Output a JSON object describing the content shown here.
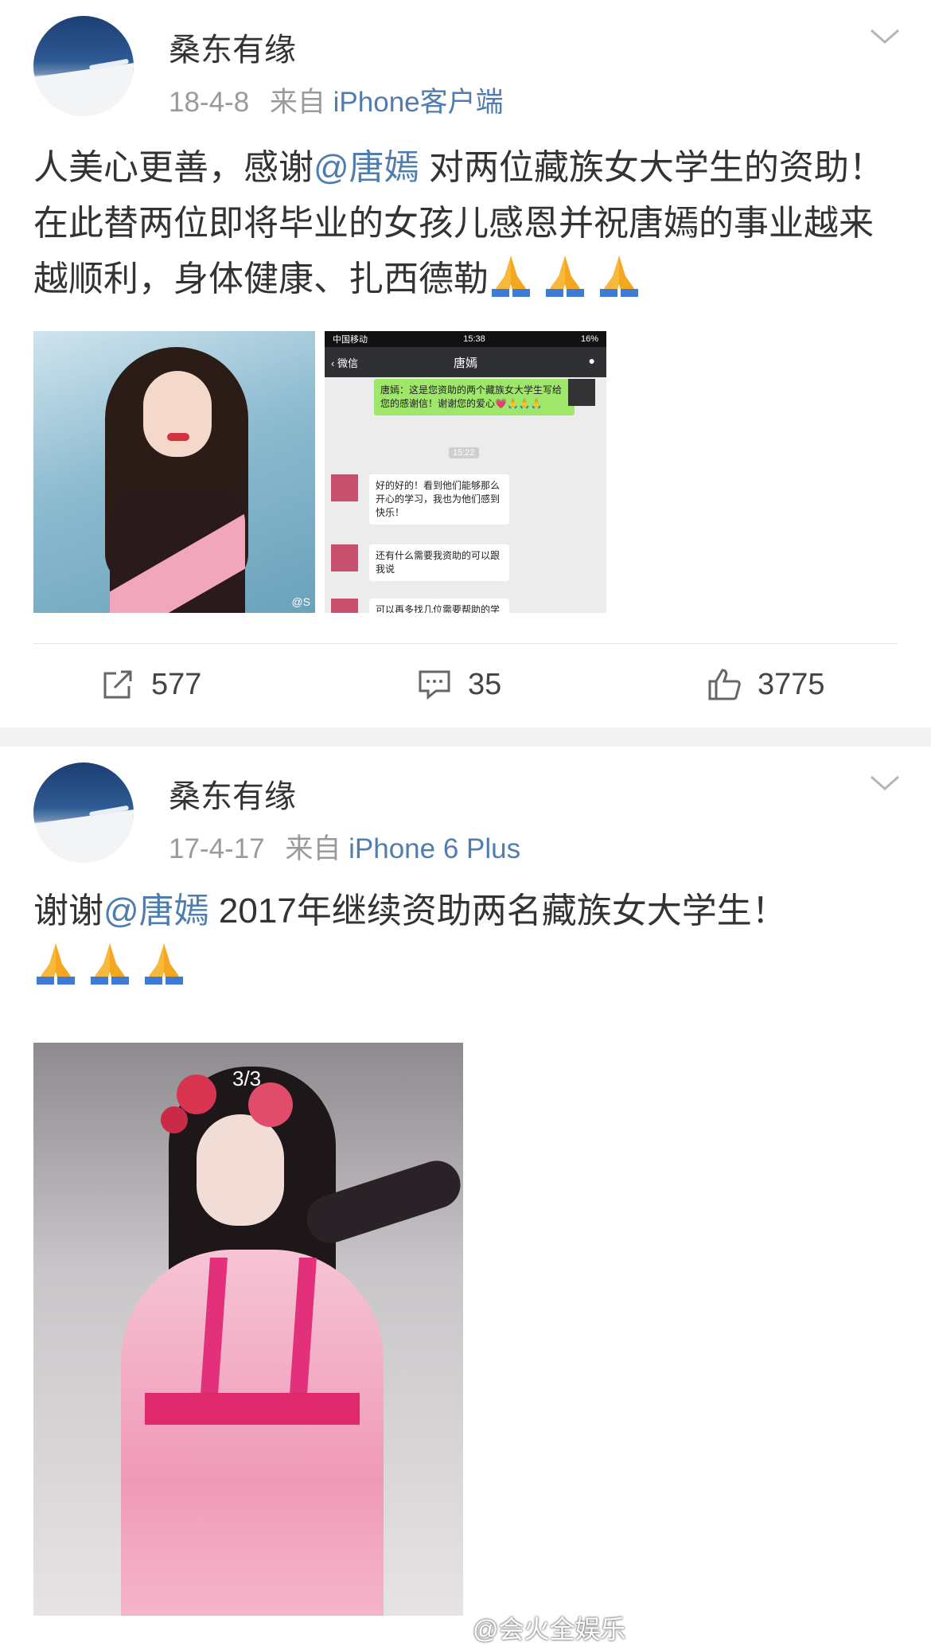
{
  "posts": [
    {
      "username": "桑东有缘",
      "date": "18-4-8",
      "from_label": "来自",
      "source": "iPhone客户端",
      "text_before_mention": "人美心更善，感谢",
      "mention": "@唐嫣",
      "text_after_mention": " 对两位藏族女大学生的资助！ 在此替两位即将毕业的女孩儿感恩并祝唐嫣的事业越来越顺利，身体健康、扎西德勒",
      "emoji_count": 3,
      "images": [
        {
          "name": "portrait-photo",
          "watermark": "@S"
        },
        {
          "name": "wechat-screenshot",
          "status_carrier": "中国移动",
          "status_time": "15:38",
          "status_battery": "16%",
          "nav_back": "微信",
          "nav_title": "唐嫣",
          "msg_sent": "唐嫣：这是您资助的两个藏族女大学生写给您的感谢信！谢谢您的爱心💗🙏🙏🙏",
          "msg_time": "15:22",
          "msg_reply_1": "好的好的！看到他们能够那么开心的学习，我也为他们感到快乐！",
          "msg_reply_2": "还有什么需要我资助的可以跟我说",
          "msg_reply_3": "可以再多找几位需要帮助的学"
        }
      ],
      "actions": {
        "repost": "577",
        "comment": "35",
        "like": "3775"
      }
    },
    {
      "username": "桑东有缘",
      "date": "17-4-17",
      "from_label": "来自",
      "source": "iPhone 6 Plus",
      "text_before_mention": "谢谢",
      "mention": "@唐嫣",
      "text_after_mention": " 2017年继续资助两名藏族女大学生！",
      "emoji_count": 3,
      "images": [
        {
          "name": "costume-photo",
          "counter": "3/3"
        }
      ]
    }
  ],
  "watermark": "@会火全娱乐",
  "colors": {
    "link": "#507daf",
    "text": "#333333",
    "meta": "#9a9a9a",
    "separator": "#f2f2f2"
  }
}
